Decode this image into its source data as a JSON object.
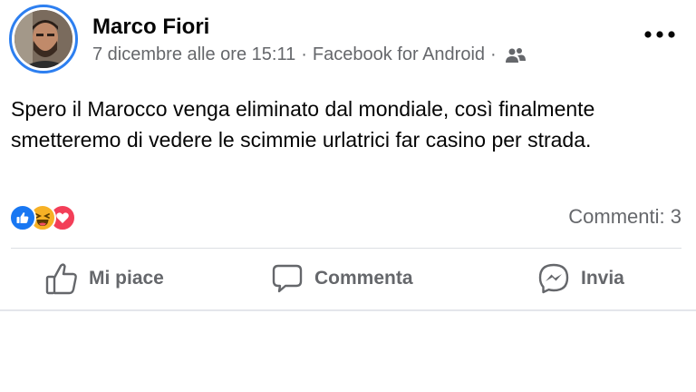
{
  "post": {
    "author": "Marco Fiori",
    "timestamp": "7 dicembre alle ore 15:11",
    "separator": "·",
    "source": "Facebook for Android",
    "audience_icon": "friends-icon",
    "more_icon": "more-options-icon",
    "text": "Spero il Marocco venga eliminato dal mondiale, così finalmente smetteremo di vedere le scimmie urlatrici far casino per strada."
  },
  "reactions": {
    "types": [
      "like",
      "haha",
      "love"
    ],
    "comments_label": "Commenti: 3"
  },
  "actions": {
    "like_label": "Mi piace",
    "comment_label": "Commenta",
    "share_label": "Invia"
  },
  "colors": {
    "accent": "#1877f2",
    "secondary_text": "#65676b",
    "love": "#f33e58",
    "haha": "#f7b125"
  }
}
